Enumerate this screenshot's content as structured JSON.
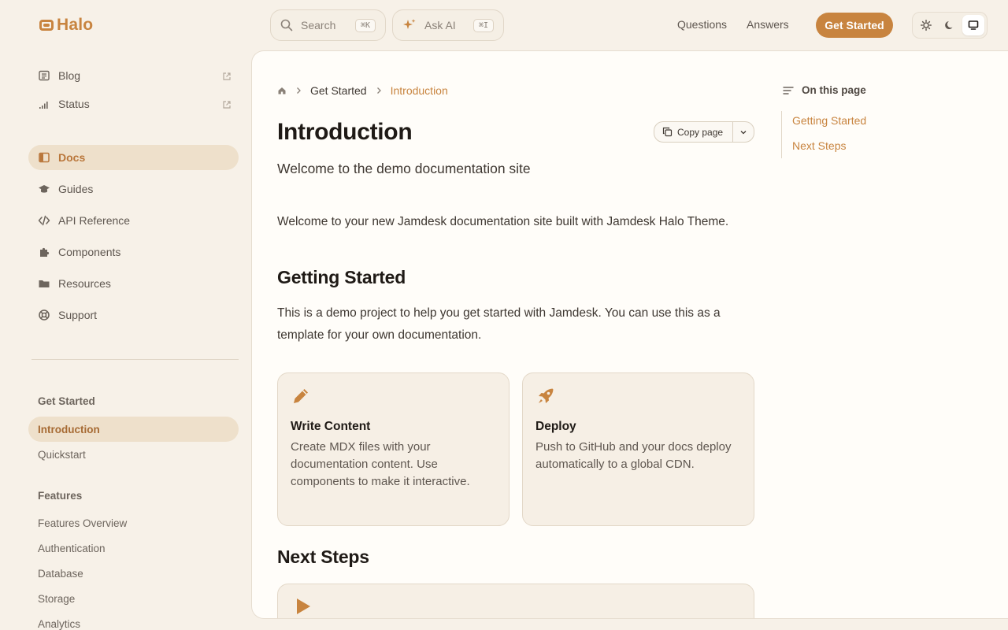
{
  "brand": {
    "name": "Halo"
  },
  "header": {
    "search_label": "Search",
    "search_shortcut": "⌘K",
    "ask_label": "Ask AI",
    "ask_shortcut": "⌘I",
    "nav": [
      "Questions",
      "Answers"
    ],
    "cta_label": "Get Started",
    "theme_active": "system"
  },
  "sidebar": {
    "links": [
      {
        "label": "Blog",
        "icon": "newspaper-icon",
        "external": true
      },
      {
        "label": "Status",
        "icon": "signal-icon",
        "external": true
      }
    ],
    "tabs": [
      {
        "label": "Docs",
        "icon": "book-icon",
        "active": true
      },
      {
        "label": "Guides",
        "icon": "graduation-cap-icon"
      },
      {
        "label": "API Reference",
        "icon": "code-icon"
      },
      {
        "label": "Components",
        "icon": "puzzle-icon"
      },
      {
        "label": "Resources",
        "icon": "folder-icon"
      },
      {
        "label": "Support",
        "icon": "life-ring-icon"
      }
    ],
    "groups": [
      {
        "title": "Get Started",
        "items": [
          "Introduction",
          "Quickstart"
        ],
        "active": "Introduction"
      },
      {
        "title": "Features",
        "items": [
          "Features Overview",
          "Authentication",
          "Database",
          "Storage",
          "Analytics"
        ]
      }
    ]
  },
  "page": {
    "breadcrumb": [
      "Get Started",
      "Introduction"
    ],
    "title": "Introduction",
    "subtitle": "Welcome to the demo documentation site",
    "copy_label": "Copy page",
    "intro": "Welcome to your new Jamdesk documentation site built with Jamdesk Halo Theme.",
    "section1_title": "Getting Started",
    "section1_body": "This is a demo project to help you get started with Jamdesk. You can use this as a template for your own documentation.",
    "cards": [
      {
        "icon": "pencil-icon",
        "title": "Write Content",
        "desc": "Create MDX files with your documentation content. Use components to make it interactive."
      },
      {
        "icon": "rocket-icon",
        "title": "Deploy",
        "desc": "Push to GitHub and your docs deploy automatically to a global CDN."
      }
    ],
    "section2_title": "Next Steps",
    "next_card_icon": "play-icon"
  },
  "toc": {
    "title": "On this page",
    "items": [
      "Getting Started",
      "Next Steps"
    ]
  },
  "colors": {
    "accent": "#c8843f",
    "background": "#f7f1e8",
    "content_bg": "#fffdf9",
    "card_bg": "#f6efe5"
  }
}
